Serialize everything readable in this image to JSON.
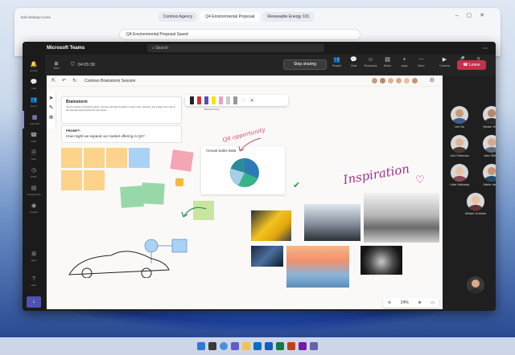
{
  "browser": {
    "corner_title": "Edit desktop Icons",
    "tabs": [
      "Contoso Agency",
      "Q4 Environmental Proposal",
      "Renewable Energy 101"
    ],
    "address": "Q4 Environmental Proposal  Saved"
  },
  "teams": {
    "app_title": "Microsoft Teams",
    "search_placeholder": "Search",
    "rail": [
      {
        "label": "Activity",
        "icon": "bell-icon",
        "glyph": "🔔"
      },
      {
        "label": "Chat",
        "icon": "chat-icon",
        "glyph": "💬"
      },
      {
        "label": "Teams",
        "icon": "teams-icon",
        "glyph": "👥"
      },
      {
        "label": "Calendar",
        "icon": "calendar-icon",
        "glyph": "▦"
      },
      {
        "label": "Calls",
        "icon": "phone-icon",
        "glyph": "☎"
      },
      {
        "label": "Files",
        "icon": "file-icon",
        "glyph": "🗎"
      },
      {
        "label": "Shifts",
        "icon": "clock-icon",
        "glyph": "◷"
      },
      {
        "label": "Assignments",
        "icon": "clipboard-icon",
        "glyph": "▤"
      },
      {
        "label": "Insights",
        "icon": "chart-icon",
        "glyph": "◉"
      },
      {
        "label": "Apps",
        "icon": "apps-icon",
        "glyph": "⊞"
      },
      {
        "label": "Help",
        "icon": "help-icon",
        "glyph": "?"
      }
    ],
    "meeting": {
      "view_label": "View",
      "timer": "04:05:38",
      "stop_sharing": "Stop sharing",
      "buttons": [
        {
          "label": "People",
          "icon": "people-icon",
          "glyph": "👥"
        },
        {
          "label": "Chat",
          "icon": "chat-icon",
          "glyph": "💬"
        },
        {
          "label": "Reactions",
          "icon": "smile-icon",
          "glyph": "☺"
        },
        {
          "label": "Notes",
          "icon": "notes-icon",
          "glyph": "▤"
        },
        {
          "label": "Apps",
          "icon": "plus-icon",
          "glyph": "+"
        },
        {
          "label": "More",
          "icon": "more-icon",
          "glyph": "⋯"
        }
      ],
      "media": [
        {
          "label": "Camera",
          "icon": "camera-icon",
          "glyph": "▶"
        },
        {
          "label": "Mic",
          "icon": "mic-icon",
          "glyph": "🎤"
        },
        {
          "label": "Share",
          "icon": "share-icon",
          "glyph": "⇧"
        }
      ],
      "leave": "Leave"
    }
  },
  "whiteboard": {
    "title": "Contoso Brainstorm Session",
    "brainstorm_title": "Brainstorm",
    "brainstorm_text": "Use the session to brainstorm ideas. The team will share thoughts on sticky notes, sketches, and images, then vote on the strongest options before the next review.",
    "prompt_label": "PROMPT:",
    "prompt_question": "How might we expand our market offering in Q4?",
    "pen_tray_label": "Brainstorming",
    "chart_title": "Annual Sales Data",
    "q4_annotation": "Q4 opportunity",
    "inspiration": "Inspiration",
    "zoom": "24%",
    "colors": {
      "accent": "#8b8cf8",
      "red_ink": "#d24a6a",
      "purple_ink": "#a0308f"
    }
  },
  "participants": [
    {
      "name": "Lee Gu",
      "skin": "#c89a7a",
      "shirt": "#3b5b8c"
    },
    {
      "name": "Nestor Wilke",
      "skin": "#b8876a",
      "shirt": "#2b2b2b"
    },
    {
      "name": "Joni Sherman",
      "skin": "#e0b394",
      "shirt": "#4a3a2e"
    },
    {
      "name": "Alex Wilber",
      "skin": "#d9a98a",
      "shirt": "#5b6b7c"
    },
    {
      "name": "Lidia Holloway",
      "skin": "#e6c1a3",
      "shirt": "#8a4a52"
    },
    {
      "name": "Adele Vance",
      "skin": "#c99373",
      "shirt": "#1f4a6a"
    },
    {
      "name": "Miriam Graham",
      "skin": "#e8bfa1",
      "shirt": "#6b3030"
    }
  ]
}
